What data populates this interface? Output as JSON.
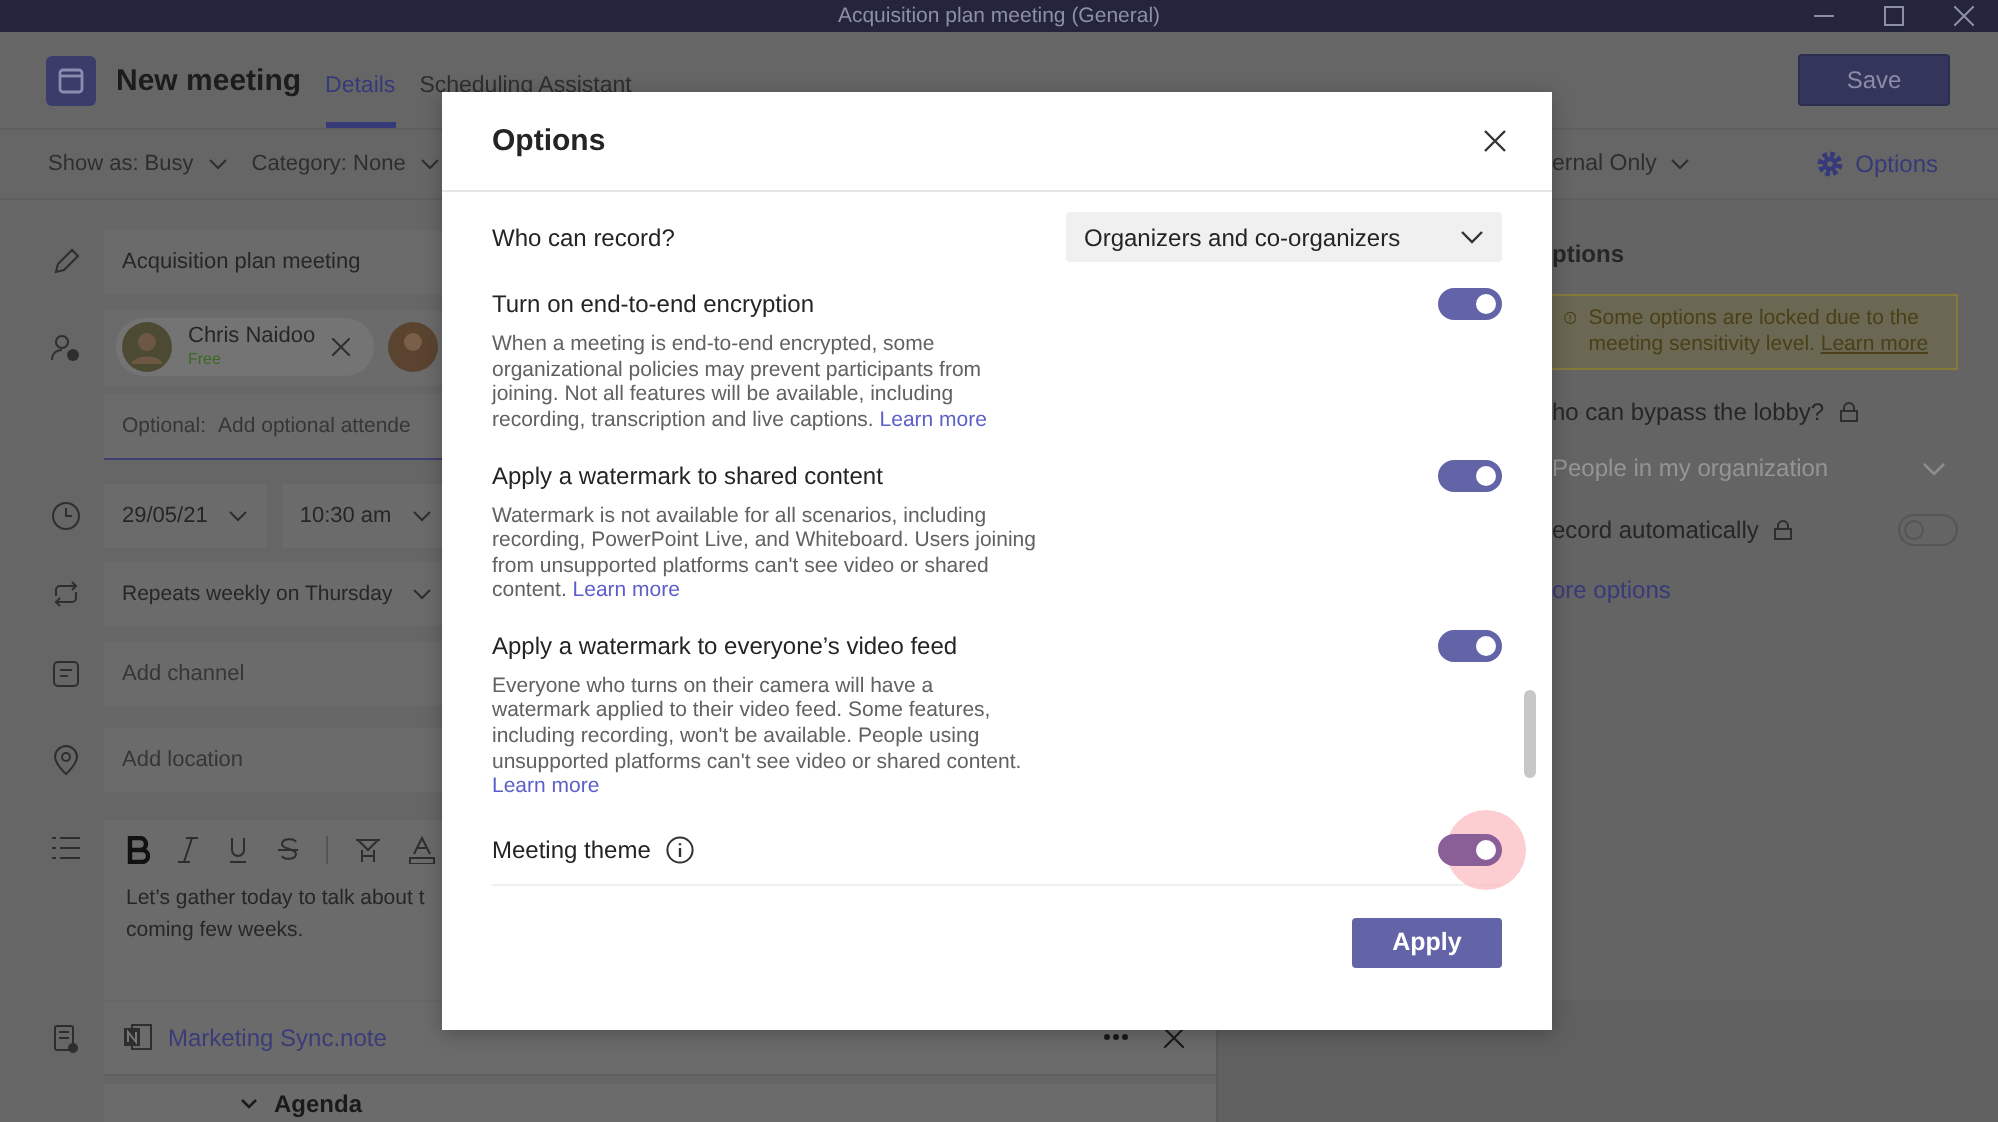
{
  "window": {
    "title": "Acquisition plan meeting (General)"
  },
  "header": {
    "title": "New meeting",
    "tabs": [
      {
        "label": "Details",
        "selected": true
      },
      {
        "label": "Scheduling Assistant",
        "selected": false
      }
    ],
    "save_button": "Save"
  },
  "toolbar": {
    "show_as": "Show as: Busy",
    "category": "Category: None",
    "column_3": "ernal Only",
    "options_button": "Options"
  },
  "form": {
    "title": "Acquisition plan meeting",
    "attendees": [
      {
        "name": "Chris Naidoo",
        "status": "Free"
      }
    ],
    "optional_label": "Optional:",
    "optional_placeholder": "Add optional attende",
    "date": "29/05/21",
    "time": "10:30 am",
    "repeat": "Repeats weekly on Thursday",
    "channel_placeholder": "Add channel",
    "location_placeholder": "Add location",
    "body_lines": [
      "Let’s gather today to talk about t",
      "coming few weeks."
    ],
    "note_link": "Marketing Sync.note",
    "agenda": "Agenda"
  },
  "side_panel": {
    "title": "ptions",
    "warning": {
      "text": "Some options are locked due to the meeting sensitivity level.",
      "link": "Learn more"
    },
    "settings": [
      {
        "kind": "dropdown",
        "label": "ho can bypass the lobby?",
        "locked": true,
        "value": "People in my organization",
        "disabled": true
      },
      {
        "kind": "toggle",
        "label": "ecord automatically",
        "locked": true,
        "on": false
      }
    ],
    "more_link": "ore options"
  },
  "dialog": {
    "title": "Options",
    "settings": [
      {
        "kind": "dropdown",
        "label": "Who can record?",
        "value": "Organizers and co-organizers"
      },
      {
        "kind": "toggle",
        "label": "Turn on end-to-end encryption",
        "on": true,
        "description": "When a meeting is end-to-end encrypted, some organizational policies may prevent participants from joining. Not all features will be available, including recording, transcription and live captions.",
        "link": "Learn more"
      },
      {
        "kind": "toggle",
        "label": "Apply a watermark to shared content",
        "on": true,
        "description": "Watermark is not available for all scenarios, including recording, PowerPoint Live, and Whiteboard. Users joining from unsupported platforms can't see video or shared content.",
        "link": "Learn more"
      },
      {
        "kind": "toggle",
        "label": "Apply a watermark to everyone’s video feed",
        "on": true,
        "description": "Everyone who turns on their camera will have a watermark applied to their video feed. Some features, including recording, won't be available. People using unsupported platforms can't see video or shared content.",
        "link": "Learn more"
      },
      {
        "kind": "toggle",
        "label": "Meeting theme",
        "on": true,
        "info": true,
        "hovered": true
      }
    ],
    "apply_button": "Apply"
  }
}
